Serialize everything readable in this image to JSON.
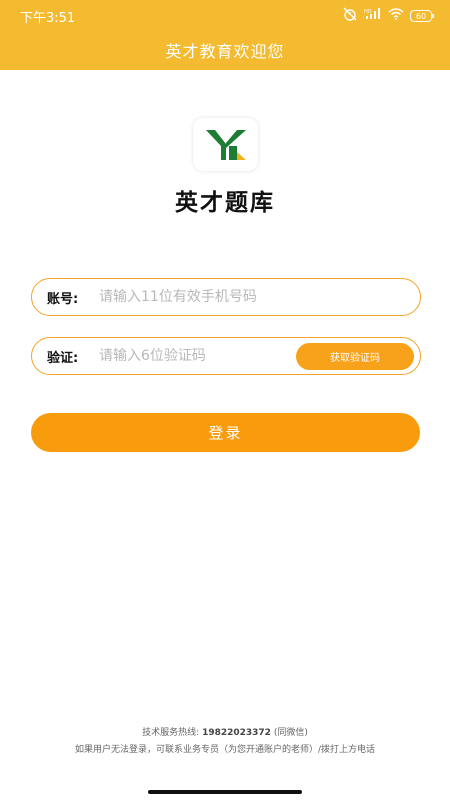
{
  "status_bar": {
    "time": "下午3:51",
    "battery": "60",
    "icons": [
      "alarm-off-icon",
      "hd-signal-icon",
      "wifi-icon",
      "battery-icon"
    ]
  },
  "header": {
    "title": "英才教育欢迎您",
    "background": "#f4bb30"
  },
  "app": {
    "name": "英才题库",
    "logo_icon": "yingcai-logo-icon",
    "logo_colors": [
      "#1e7d34",
      "#f2b019"
    ]
  },
  "form": {
    "account_label": "账号:",
    "account_placeholder": "请输入11位有效手机号码",
    "code_label": "验证:",
    "code_placeholder": "请输入6位验证码",
    "get_code_button": "获取验证码",
    "login_button": "登录",
    "accent": "#f89c0e"
  },
  "footer": {
    "hotline_label": "技术服务热线:",
    "hotline_number": "19822023372",
    "hotline_suffix": "(同微信)",
    "note": "如果用户无法登录，可联系业务专员（为您开通账户的老师）/拨打上方电话"
  }
}
